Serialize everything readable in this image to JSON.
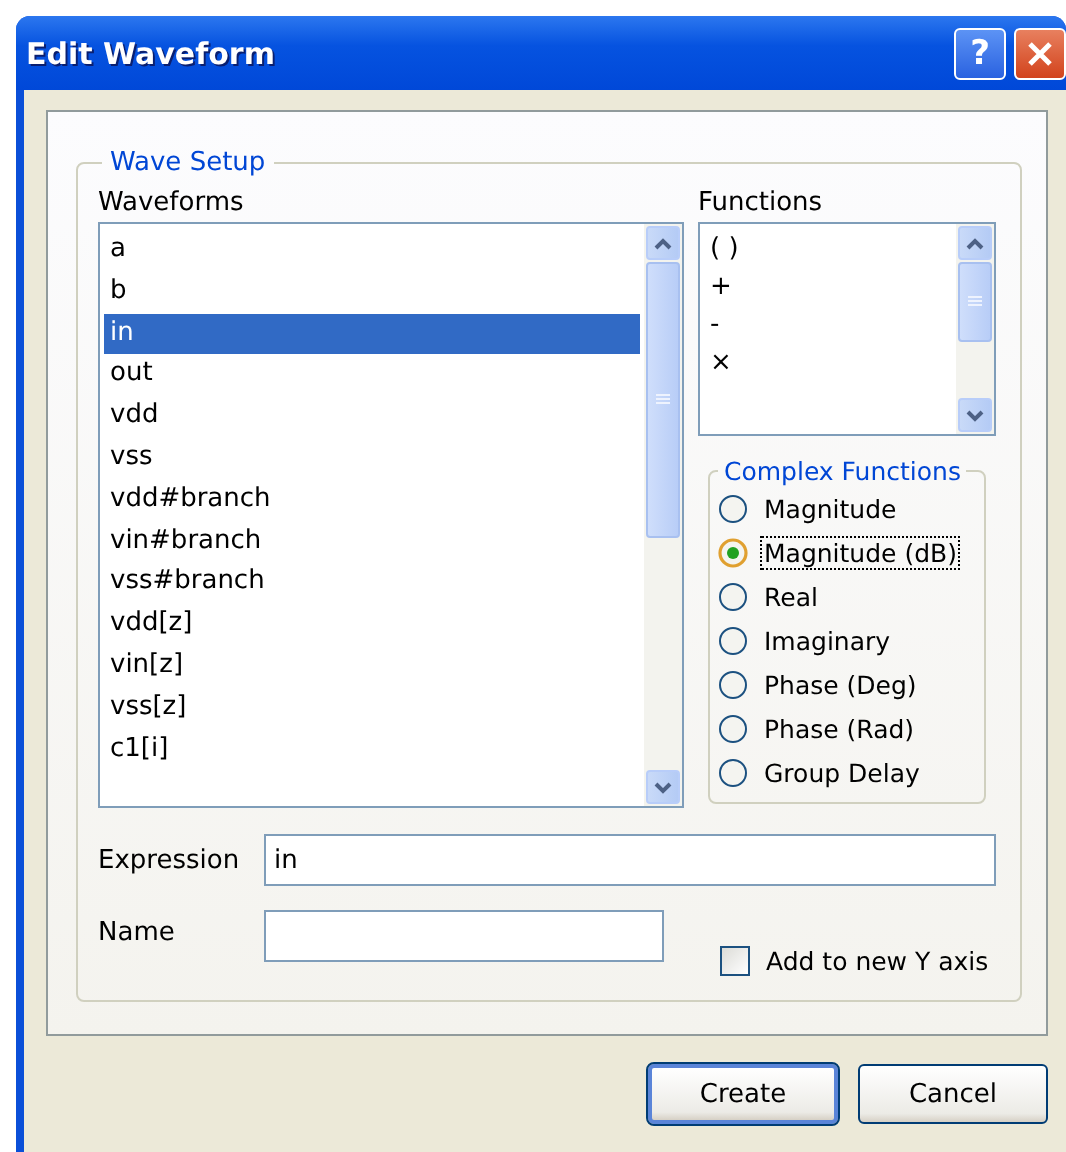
{
  "window": {
    "title": "Edit Waveform",
    "help": "?"
  },
  "wave_setup": {
    "title": "Wave Setup",
    "waveforms": {
      "label": "Waveforms",
      "items": [
        {
          "label": "a",
          "selected": false
        },
        {
          "label": "b",
          "selected": false
        },
        {
          "label": "in",
          "selected": true
        },
        {
          "label": "out",
          "selected": false
        },
        {
          "label": "vdd",
          "selected": false
        },
        {
          "label": "vss",
          "selected": false
        },
        {
          "label": "vdd#branch",
          "selected": false
        },
        {
          "label": "vin#branch",
          "selected": false
        },
        {
          "label": "vss#branch",
          "selected": false
        },
        {
          "label": "vdd[z]",
          "selected": false
        },
        {
          "label": "vin[z]",
          "selected": false
        },
        {
          "label": "vss[z]",
          "selected": false
        },
        {
          "label": "c1[i]",
          "selected": false
        }
      ]
    },
    "functions": {
      "label": "Functions",
      "items": [
        {
          "label": "( )",
          "selected": false
        },
        {
          "label": "+",
          "selected": false
        },
        {
          "label": "-",
          "selected": false
        },
        {
          "label": "×",
          "selected": false
        }
      ]
    },
    "complex_functions": {
      "title": "Complex Functions",
      "options": [
        {
          "label": "Magnitude",
          "selected": false
        },
        {
          "label": "Magnitude (dB)",
          "selected": true
        },
        {
          "label": "Real",
          "selected": false
        },
        {
          "label": "Imaginary",
          "selected": false
        },
        {
          "label": "Phase (Deg)",
          "selected": false
        },
        {
          "label": "Phase (Rad)",
          "selected": false
        },
        {
          "label": "Group Delay",
          "selected": false
        }
      ]
    },
    "expression": {
      "label": "Expression",
      "value": "in"
    },
    "name": {
      "label": "Name"
    },
    "add_to_new_y_axis": {
      "label": "Add to new Y axis",
      "checked": false
    }
  },
  "buttons": [
    {
      "label": "Create",
      "default": true
    },
    {
      "label": "Cancel",
      "default": false
    }
  ]
}
